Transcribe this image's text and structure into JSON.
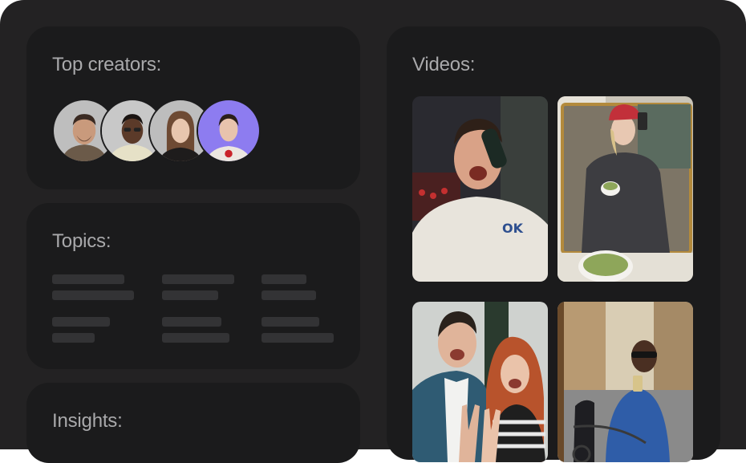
{
  "creators": {
    "title": "Top creators:",
    "avatars": [
      {
        "name": "creator-1",
        "bg": "#bfbfbf"
      },
      {
        "name": "creator-2",
        "bg": "#c9c9c9"
      },
      {
        "name": "creator-3",
        "bg": "#bdbdbd"
      },
      {
        "name": "creator-4",
        "bg": "#8d7cf0"
      }
    ]
  },
  "topics": {
    "title": "Topics:"
  },
  "insights": {
    "title": "Insights:"
  },
  "videos": {
    "title": "Videos:",
    "thumbnails": [
      {
        "name": "party-selfie"
      },
      {
        "name": "mirror-selfie-matcha"
      },
      {
        "name": "friends-peace-sign"
      },
      {
        "name": "street-mirror-selfie"
      }
    ]
  },
  "colors": {
    "frame": "#232223",
    "card": "#1b1b1c",
    "title_text": "#a9a9ab",
    "placeholder": "#333335",
    "accent_avatar": "#8d7cf0"
  }
}
